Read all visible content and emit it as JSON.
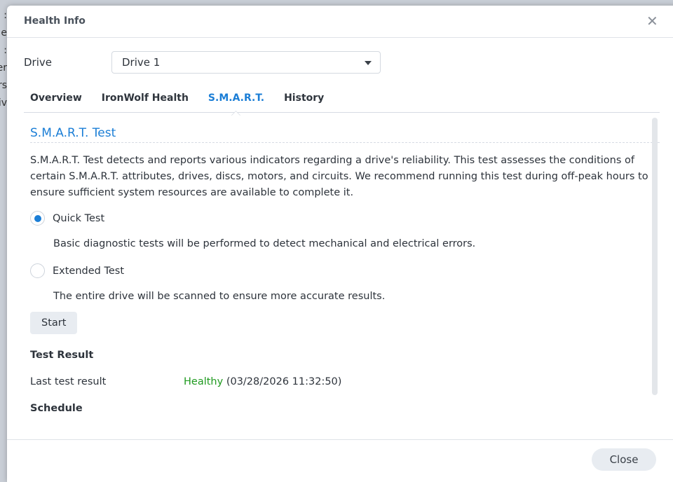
{
  "background_fragments": [
    ":",
    "e:",
    ":",
    "er",
    "rs",
    "iv"
  ],
  "dialog": {
    "title": "Health Info",
    "close_icon": "close-x-icon",
    "drive_label": "Drive",
    "drive_value": "Drive 1",
    "tabs": [
      {
        "label": "Overview",
        "active": false
      },
      {
        "label": "IronWolf Health",
        "active": false
      },
      {
        "label": "S.M.A.R.T.",
        "active": true
      },
      {
        "label": "History",
        "active": false
      }
    ],
    "section_title": "S.M.A.R.T. Test",
    "description": "S.M.A.R.T. Test detects and reports various indicators regarding a drive's reliability. This test assesses the conditions of certain S.M.A.R.T. attributes, drives, discs, motors, and circuits. We recommend running this test during off-peak hours to ensure sufficient system resources are available to complete it.",
    "options": [
      {
        "label": "Quick Test",
        "selected": true,
        "detail": "Basic diagnostic tests will be performed to detect mechanical and electrical errors."
      },
      {
        "label": "Extended Test",
        "selected": false,
        "detail": "The entire drive will be scanned to ensure more accurate results."
      }
    ],
    "start_label": "Start",
    "test_result_heading": "Test Result",
    "last_result_label": "Last test result",
    "last_result_status": "Healthy",
    "last_result_time": "(03/28/2026 11:32:50)",
    "schedule_heading": "Schedule",
    "close_label": "Close",
    "colors": {
      "accent": "#1b7ed6",
      "healthy": "#1f9a1f"
    }
  }
}
